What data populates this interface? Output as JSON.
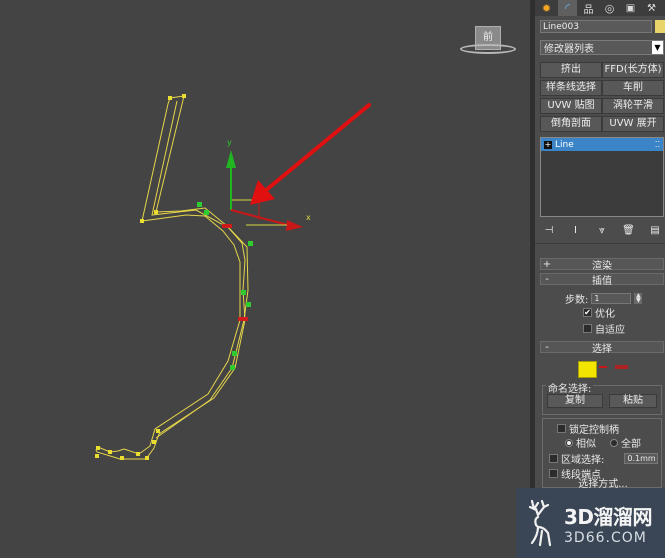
{
  "viewport": {
    "viewcube_label": "前",
    "axis_x_label": "x",
    "axis_y_label": "y"
  },
  "command_panel": {
    "tabs": [
      {
        "name": "create-tab",
        "icon": "sun-icon"
      },
      {
        "name": "modify-tab",
        "icon": "modify-arc-icon"
      },
      {
        "name": "hierarchy-tab",
        "icon": "hierarchy-icon"
      },
      {
        "name": "motion-tab",
        "icon": "motion-circle-icon"
      },
      {
        "name": "display-tab",
        "icon": "monitor-icon"
      },
      {
        "name": "utilities-tab",
        "icon": "hammer-icon"
      }
    ],
    "object_name": "Line003",
    "object_color": "#e8d46a",
    "modifier_list_label": "修改器列表",
    "modifier_buttons": [
      "挤出",
      "FFD(长方体)",
      "样条线选择",
      "车削",
      "UVW 贴图",
      "涡轮平滑",
      "倒角剖面",
      "UVW 展开"
    ],
    "stack_item": "Line",
    "rollouts": {
      "rendering": {
        "sign": "+",
        "title": "渲染"
      },
      "interpolation": {
        "sign": "-",
        "title": "插值",
        "steps_label": "步数:",
        "steps_value": "1",
        "optimize_label": "优化",
        "adaptive_label": "自适应"
      },
      "selection": {
        "sign": "-",
        "title": "选择",
        "named_sel_label": "命名选择:",
        "copy_label": "复制",
        "paste_label": "粘贴",
        "lock_handles_label": "锁定控制柄",
        "similar_label": "相似",
        "all_label": "全部",
        "area_sel_label": "区域选择:",
        "area_value": "0.1mm",
        "segment_end_label": "线段端点",
        "sel_method_label": "选择方式..."
      }
    }
  },
  "watermark": {
    "main": "3D溜溜网",
    "sub": "3D66.COM"
  },
  "colors": {
    "viewport_bg": "#444444",
    "spline": "#e6d54a",
    "vertex": "#e9de2f",
    "selected_vertex": "#2ecc2e",
    "arrow": "#e01010",
    "stack_highlight": "#3b84c8"
  }
}
